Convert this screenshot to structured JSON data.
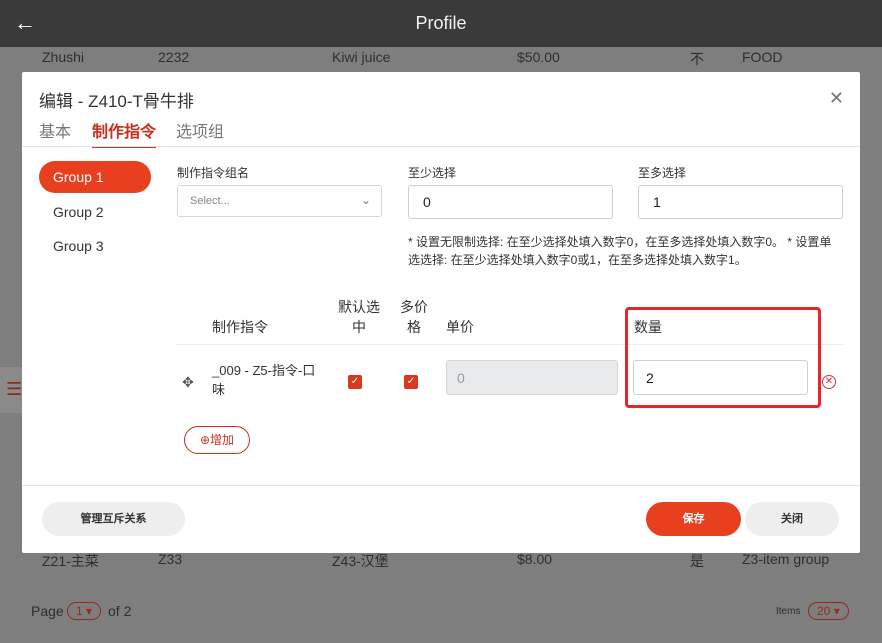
{
  "app": {
    "back_icon": "arrow-left-icon",
    "title": "Profile"
  },
  "background": {
    "rows": [
      {
        "c1": "Zhushi",
        "c2": "2232",
        "c3": "Kiwi juice",
        "c4": "$50.00",
        "c5": "不",
        "c6": "FOOD"
      },
      {
        "c1": "Z21-主菜",
        "c2": "Z33",
        "c3": "Z43-汉堡",
        "c4": "$8.00",
        "c5": "是",
        "c6": "Z3-item group"
      }
    ],
    "pager": {
      "page_label": "Page",
      "page_value": "1",
      "of_label": "of 2",
      "items_label": "Items",
      "items_value": "20"
    }
  },
  "modal": {
    "title": "编辑 - Z410-T骨牛排",
    "close_icon": "close-icon",
    "tabs": [
      {
        "label": "基本"
      },
      {
        "label": "制作指令"
      },
      {
        "label": "选项组"
      }
    ],
    "groups": [
      {
        "label": "Group 1"
      },
      {
        "label": "Group 2"
      },
      {
        "label": "Group 3"
      }
    ],
    "form": {
      "group_name_label": "制作指令组名",
      "group_name_placeholder": "Select...",
      "min_label": "至少选择",
      "min_value": "0",
      "max_label": "至多选择",
      "max_value": "1",
      "hint": "* 设置无限制选择: 在至少选择处填入数字0，在至多选择处填入数字0。 * 设置单选选择: 在至少选择处填入数字0或1，在至多选择处填入数字1。"
    },
    "table": {
      "headers": {
        "instruction": "制作指令",
        "default_line1": "默认选",
        "default_line2": "中",
        "multi_line1": "多价",
        "multi_line2": "格",
        "price": "单价",
        "quantity": "数量"
      },
      "row": {
        "name": "_009 - Z5-指令-口味",
        "default_checked": true,
        "multi_checked": true,
        "price": "0",
        "quantity": "2"
      }
    },
    "add_label": "增加",
    "footer": {
      "mutex_label": "管理互斥关系",
      "save_label": "保存",
      "close_label": "关闭"
    }
  },
  "colors": {
    "accent": "#e8401f",
    "highlight": "#e6252a",
    "appbar": "#3a3a3a"
  }
}
